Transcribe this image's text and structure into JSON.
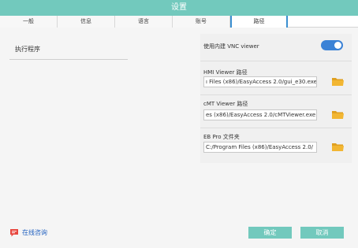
{
  "window": {
    "title": "设置"
  },
  "tabs": [
    {
      "label": "一般"
    },
    {
      "label": "信息"
    },
    {
      "label": "语言"
    },
    {
      "label": "账号"
    },
    {
      "label": "路径",
      "active": true
    }
  ],
  "left": {
    "program_label": "执行程序"
  },
  "vnc": {
    "label": "使用内建 VNC viewer",
    "enabled": true
  },
  "paths": [
    {
      "label": "HMI Viewer 路径",
      "value": "ı Files (x86)/EasyAccess 2.0/gui_e30.exe"
    },
    {
      "label": "cMT Viewer 路径",
      "value": "es (x86)/EasyAccess 2.0/cMTViewer.exe"
    },
    {
      "label": "EB Pro 文件夹",
      "value": "C:/Program Files (x86)/EasyAccess 2.0/"
    }
  ],
  "footer": {
    "consult_label": "在线咨询",
    "ok_label": "确定",
    "cancel_label": "取消"
  },
  "colors": {
    "accent": "#72c9bd",
    "toggle": "#3b82d6",
    "folder": "#f2b632",
    "link": "#1f5fbf"
  },
  "icons": {
    "folder": "folder-icon",
    "chat": "chat-icon"
  }
}
